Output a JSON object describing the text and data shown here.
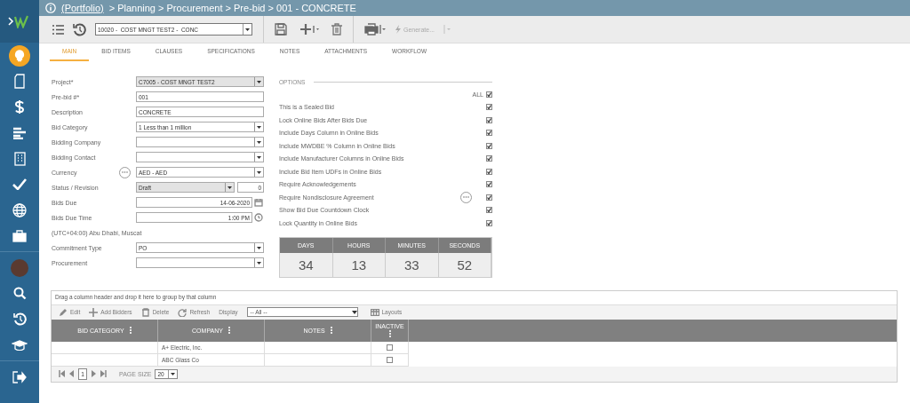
{
  "sidebar": {
    "items": [
      {
        "kind": "bulb",
        "selected": true
      },
      {
        "kind": "document",
        "selected": false
      },
      {
        "kind": "dollar",
        "selected": false
      },
      {
        "kind": "bars",
        "selected": false
      },
      {
        "kind": "building",
        "selected": false
      },
      {
        "kind": "check",
        "selected": false
      },
      {
        "kind": "globe",
        "selected": false
      },
      {
        "kind": "briefcase",
        "selected": false
      },
      {
        "kind": "divider"
      },
      {
        "kind": "avatar",
        "selected": false
      },
      {
        "kind": "search",
        "selected": false
      },
      {
        "kind": "history",
        "selected": false
      },
      {
        "kind": "cap",
        "selected": false
      },
      {
        "kind": "divider"
      },
      {
        "kind": "logout",
        "selected": false
      }
    ]
  },
  "breadcrumb": {
    "root": "(Portfolio)",
    "path": "> Planning > Procurement > Pre-bid > 001 - CONCRETE"
  },
  "toolbar": {
    "record": "10020 -  COST MNGT TEST2 -  CONC",
    "generate": {
      "label": "Generate...",
      "disabled": true
    }
  },
  "tabs": [
    {
      "label": "MAIN",
      "selected": true
    },
    {
      "label": "BID ITEMS",
      "selected": false
    },
    {
      "label": "CLAUSES",
      "selected": false
    },
    {
      "label": "SPECIFICATIONS",
      "selected": false
    },
    {
      "label": "NOTES",
      "selected": false
    },
    {
      "label": "ATTACHMENTS",
      "selected": false
    },
    {
      "label": "WORKFLOW",
      "selected": false
    }
  ],
  "form": [
    {
      "kind": "select",
      "label": "Project*",
      "value": "C7005 - COST MNGT TEST2",
      "disabled": true
    },
    {
      "kind": "text",
      "label": "Pre-bid #*",
      "value": "001"
    },
    {
      "kind": "text",
      "label": "Description",
      "value": "CONCRETE"
    },
    {
      "kind": "select",
      "label": "Bid Category",
      "value": "1 Less than 1 million",
      "disabled": false
    },
    {
      "kind": "select",
      "label": "Bidding Company",
      "disabled": false
    },
    {
      "kind": "select",
      "label": "Bidding Contact",
      "disabled": false
    },
    {
      "kind": "select",
      "label": "Currency",
      "value": "AED - AED",
      "disabled": false,
      "more": true
    },
    {
      "kind": "status",
      "label": "Status / Revision",
      "value": "Draft",
      "revision": "0",
      "disabled": true
    },
    {
      "kind": "date",
      "label": "Bids Due",
      "value": "14-06-2020"
    },
    {
      "kind": "time",
      "label": "Bids Due Time",
      "value": "1:00 PM"
    },
    {
      "kind": "note",
      "label": "(UTC+04:00) Abu Dhabi, Muscat"
    },
    {
      "kind": "select",
      "label": "Commitment Type",
      "value": "PO",
      "disabled": false
    },
    {
      "kind": "select",
      "label": "Procurement",
      "disabled": false
    }
  ],
  "options": {
    "title": "OPTIONS",
    "all_label": "ALL",
    "all_checked": true,
    "items": [
      {
        "label": "This is a Sealed Bid",
        "checked": true
      },
      {
        "label": "Lock Online Bids After Bids Due",
        "checked": true
      },
      {
        "label": "Include Days Column in Online Bids",
        "checked": true
      },
      {
        "label": "Include MWDBE % Column in Online Bids",
        "checked": true
      },
      {
        "label": "Include Manufacturer Columns in Online Bids",
        "checked": true
      },
      {
        "label": "Include Bid Item UDFs in Online Bids",
        "checked": true
      },
      {
        "label": "Require Acknowledgements",
        "checked": true
      },
      {
        "label": "Require Nondisclosure Agreement",
        "checked": true,
        "more": true
      },
      {
        "label": "Show Bid Due Countdown Clock",
        "checked": true
      },
      {
        "label": "Lock Quantity in Online Bids",
        "checked": true
      }
    ]
  },
  "countdown": [
    {
      "unit": "DAYS",
      "value": "34"
    },
    {
      "unit": "HOURS",
      "value": "13"
    },
    {
      "unit": "MINUTES",
      "value": "33"
    },
    {
      "unit": "SECONDS",
      "value": "52"
    }
  ],
  "grid": {
    "group_hint": "Drag a column header and drop it here to group by that column",
    "actions": [
      {
        "kind": "edit",
        "label": "Edit"
      },
      {
        "kind": "add",
        "label": "Add Bidders"
      },
      {
        "kind": "delete",
        "label": "Delete"
      },
      {
        "kind": "refresh",
        "label": "Refresh"
      }
    ],
    "display_label": "Display",
    "display_value": "-- All --",
    "layouts": "Layouts",
    "columns": [
      "BID CATEGORY",
      "COMPANY",
      "NOTES",
      "INACTIVE"
    ],
    "rows": [
      {
        "company": "A+ Electric, Inc.",
        "inactive": false
      },
      {
        "company": "ABC Glass Co",
        "inactive": false
      }
    ],
    "pager": {
      "page": "1",
      "page_size_label": "PAGE SIZE",
      "page_size": "20"
    }
  }
}
